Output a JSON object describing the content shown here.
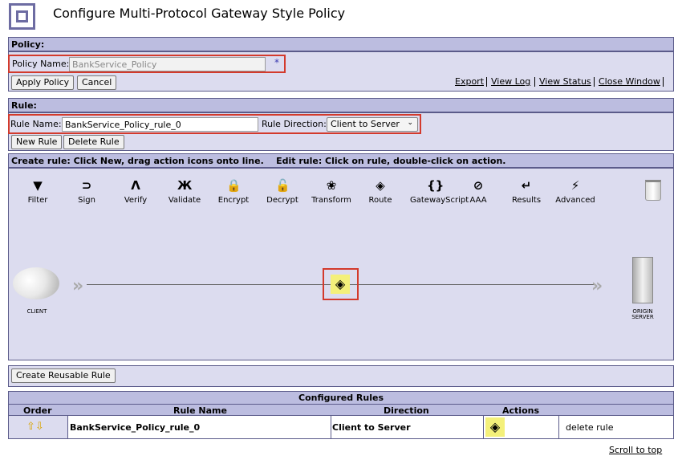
{
  "page": {
    "title": "Configure Multi-Protocol Gateway Style Policy"
  },
  "policy": {
    "section_label": "Policy:",
    "name_label": "Policy Name:",
    "name_value": "BankService_Policy",
    "required_marker": "*",
    "apply_button": "Apply Policy",
    "cancel_button": "Cancel",
    "links": [
      "Export",
      "View Log",
      "View Status",
      "Close Window"
    ]
  },
  "rule": {
    "section_label": "Rule:",
    "name_label": "Rule Name:",
    "name_value": "BankService_Policy_rule_0",
    "direction_label": "Rule Direction:",
    "direction_value": "Client to Server",
    "new_button": "New Rule",
    "delete_button": "Delete Rule"
  },
  "canvas": {
    "instructions": "Create rule: Click New, drag action icons onto line.    Edit rule: Click on rule, double-click on action.",
    "actions": [
      {
        "label": "Filter",
        "icon": "filter-icon",
        "glyph": "▼"
      },
      {
        "label": "Sign",
        "icon": "sign-icon",
        "glyph": "⊃"
      },
      {
        "label": "Verify",
        "icon": "verify-icon",
        "glyph": "Ʌ"
      },
      {
        "label": "Validate",
        "icon": "validate-icon",
        "glyph": "Ж"
      },
      {
        "label": "Encrypt",
        "icon": "encrypt-icon",
        "glyph": "🔒"
      },
      {
        "label": "Decrypt",
        "icon": "decrypt-icon",
        "glyph": "🔓"
      },
      {
        "label": "Transform",
        "icon": "transform-icon",
        "glyph": "❀"
      },
      {
        "label": "Route",
        "icon": "route-icon",
        "glyph": "◈"
      },
      {
        "label": "GatewayScript",
        "icon": "gatewayscript-icon",
        "glyph": "{}"
      },
      {
        "label": "AAA",
        "icon": "aaa-icon",
        "glyph": "⊘"
      },
      {
        "label": "Results",
        "icon": "results-icon",
        "glyph": "↵"
      },
      {
        "label": "Advanced",
        "icon": "advanced-icon",
        "glyph": "⚡"
      }
    ],
    "client_label": "CLIENT",
    "server_label_1": "ORIGIN",
    "server_label_2": "SERVER"
  },
  "reusable": {
    "button": "Create Reusable Rule"
  },
  "configured_rules": {
    "title": "Configured Rules",
    "headers": [
      "Order",
      "Rule Name",
      "Direction",
      "Actions"
    ],
    "rows": [
      {
        "order": "⇧⇩",
        "name": "BankService_Policy_rule_0",
        "direction": "Client to Server",
        "delete": "delete rule"
      }
    ]
  },
  "footer": {
    "scroll_top": "Scroll to top"
  },
  "colors": {
    "bar": "#bcbde0",
    "panel": "#dcdcef",
    "highlight": "#d33a2c",
    "match_yellow": "#f4f07a"
  }
}
